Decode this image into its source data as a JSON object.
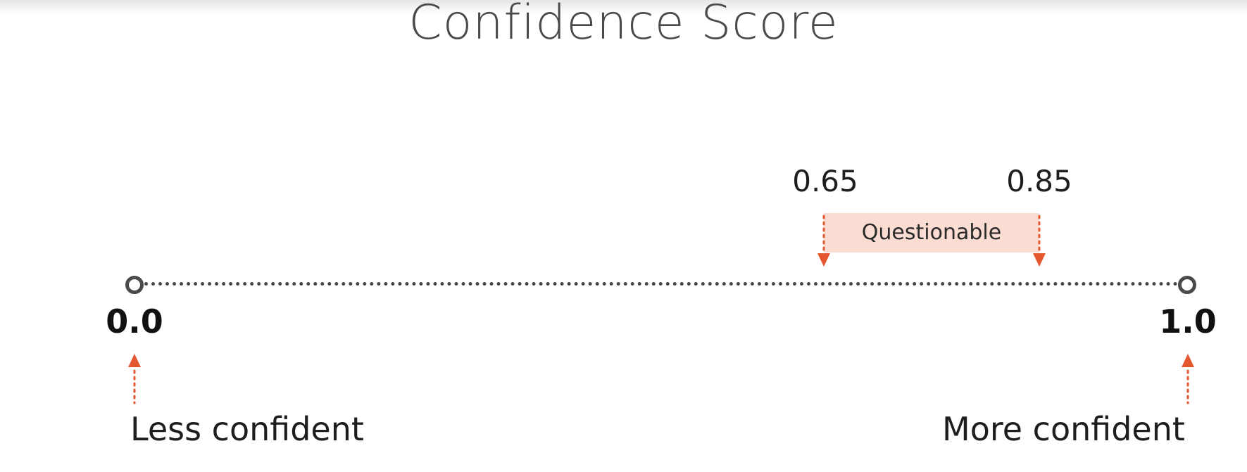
{
  "title": "Confidence Score",
  "scale": {
    "min_label": "0.0",
    "max_label": "1.0",
    "min_caption": "Less confident",
    "max_caption": "More confident"
  },
  "band": {
    "label": "Questionable",
    "low_label": "0.65",
    "high_label": "0.85",
    "low": 0.65,
    "high": 0.85
  },
  "colors": {
    "accent": "#e4572e",
    "band_fill": "#fbdcd2",
    "axis": "#4a4a4a",
    "title": "#4a4a4a"
  }
}
